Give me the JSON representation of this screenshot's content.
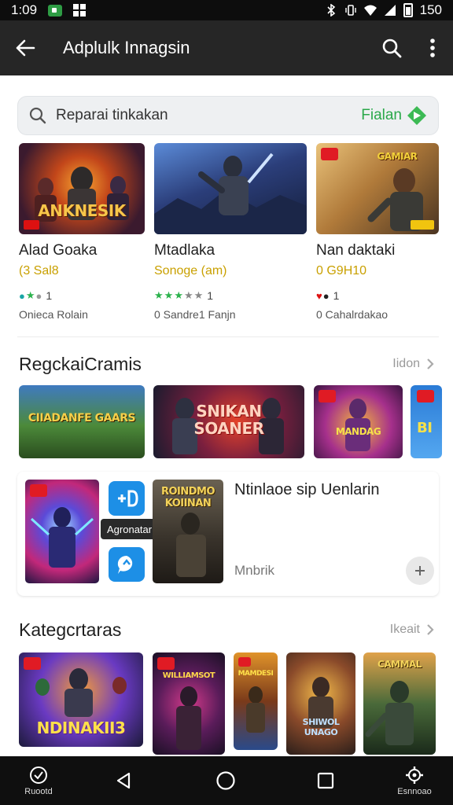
{
  "status_bar": {
    "time": "1:09",
    "battery": "150"
  },
  "app_bar": {
    "title": "Adplulk Innagsin"
  },
  "search": {
    "placeholder": "Reparai tinkakan",
    "brand": "Fialan"
  },
  "top_games": [
    {
      "thumb_text": "ANKNESIK",
      "title": "Alad Goaka",
      "price": "(3 Sal8",
      "rating_count": "1",
      "developer": "Onieca Rolain"
    },
    {
      "thumb_text": "",
      "title": "Mtadlaka",
      "price": "Sonoge (am)",
      "rating_count": "1",
      "developer": "0 Sandre1 Fanjn"
    },
    {
      "thumb_text": "GAMIAR",
      "title": "Nan daktaki",
      "price": "0 G9H10",
      "rating_count": "1",
      "developer": "0 Cahalrdakao"
    }
  ],
  "recommended": {
    "title": "RegckaiCramis",
    "more": "Iidon",
    "items": [
      {
        "text": "CIIADANFE GAARS"
      },
      {
        "text": "SNIKAN SOANER"
      },
      {
        "text": "MANDAG"
      },
      {
        "text": "BI"
      }
    ]
  },
  "featured": {
    "title": "Ntinlaoe sip Uenlarin",
    "subtitle": "Mnbrik",
    "tooltip": "Agronatar",
    "thumb_text": "ROINDMO KOIINAN"
  },
  "categories": {
    "title": "Kategcrtaras",
    "more": "Ikeait",
    "items": [
      {
        "text": "NDINAKII3"
      },
      {
        "text": "WILLIAMSOT"
      },
      {
        "text": "MAMDESI"
      },
      {
        "text": "SHIWOL UNAGO"
      },
      {
        "text": "CAMMAL"
      }
    ]
  },
  "nav_bar": {
    "left_label": "Ruootd",
    "right_label": "Esnnoao"
  },
  "colors": {
    "app_bar": "#262626",
    "brand_green": "#2aa84a",
    "price_gold": "#c9a000"
  }
}
